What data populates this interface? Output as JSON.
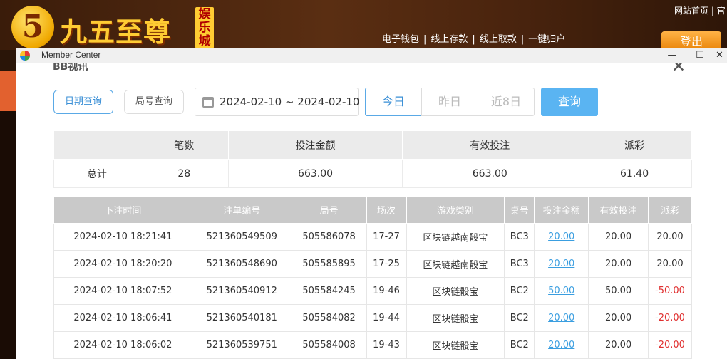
{
  "site": {
    "logo_digit": "5",
    "logo_name": "九五至尊",
    "logo_badge": "娱乐城",
    "top_links": "网站首页 | 官",
    "nav": [
      "电子钱包",
      "线上存款",
      "线上取款",
      "一键归户"
    ],
    "logout_label": "登出"
  },
  "window": {
    "title": "Member Center",
    "minimize": "—",
    "maximize": "☐",
    "close": "✕"
  },
  "panel": {
    "title": "BB视讯",
    "close": "✕"
  },
  "filters": {
    "mode_date": "日期查询",
    "mode_round": "局号查询",
    "date_range": "2024-02-10 ~ 2024-02-10",
    "today": "今日",
    "yesterday": "昨日",
    "last8": "近8日",
    "query": "查询"
  },
  "summary": {
    "headers": [
      "",
      "笔数",
      "投注金额",
      "有效投注",
      "派彩"
    ],
    "row": [
      "总计",
      "28",
      "663.00",
      "663.00",
      "61.40"
    ]
  },
  "details": {
    "headers": [
      "下注时间",
      "注单编号",
      "局号",
      "场次",
      "游戏类别",
      "桌号",
      "投注金额",
      "有效投注",
      "派彩"
    ],
    "rows": [
      [
        "2024-02-10 18:21:41",
        "521360549509",
        "505586078",
        "17-27",
        "区块链越南骰宝",
        "BC3",
        "20.00",
        "20.00",
        "20.00"
      ],
      [
        "2024-02-10 18:20:20",
        "521360548690",
        "505585895",
        "17-25",
        "区块链越南骰宝",
        "BC3",
        "20.00",
        "20.00",
        "20.00"
      ],
      [
        "2024-02-10 18:07:52",
        "521360540912",
        "505584245",
        "19-46",
        "区块链骰宝",
        "BC2",
        "50.00",
        "50.00",
        "-50.00"
      ],
      [
        "2024-02-10 18:06:41",
        "521360540181",
        "505584082",
        "19-44",
        "区块链骰宝",
        "BC2",
        "20.00",
        "20.00",
        "-20.00"
      ],
      [
        "2024-02-10 18:06:02",
        "521360539751",
        "505584008",
        "19-43",
        "区块链骰宝",
        "BC2",
        "20.00",
        "20.00",
        "-20.00"
      ]
    ]
  },
  "colors": {
    "accent": "#5ab4f2",
    "link": "#3a9ee0",
    "negative": "#e03030"
  }
}
